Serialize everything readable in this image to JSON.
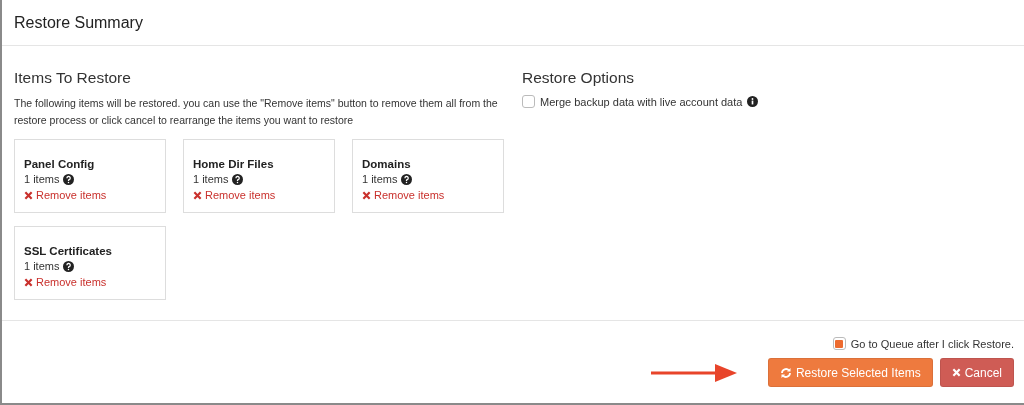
{
  "header": {
    "title": "Restore Summary"
  },
  "items_section": {
    "heading": "Items To Restore",
    "description": "The following items will be restored. you can use the \"Remove items\" button to remove them all from the restore process or click cancel to rearrange the items you want to restore",
    "items": [
      {
        "name": "Panel Config",
        "count": "1 items",
        "remove": "Remove items"
      },
      {
        "name": "Home Dir Files",
        "count": "1 items",
        "remove": "Remove items"
      },
      {
        "name": "Domains",
        "count": "1 items",
        "remove": "Remove items"
      },
      {
        "name": "SSL Certificates",
        "count": "1 items",
        "remove": "Remove items"
      }
    ]
  },
  "options_section": {
    "heading": "Restore Options",
    "options": [
      {
        "label": "Merge backup data with live account data",
        "checked": false
      }
    ]
  },
  "footer": {
    "queue_option": {
      "label": "Go to Queue after I click Restore.",
      "checked": true
    },
    "restore_button": "Restore Selected Items",
    "cancel_button": "Cancel"
  }
}
